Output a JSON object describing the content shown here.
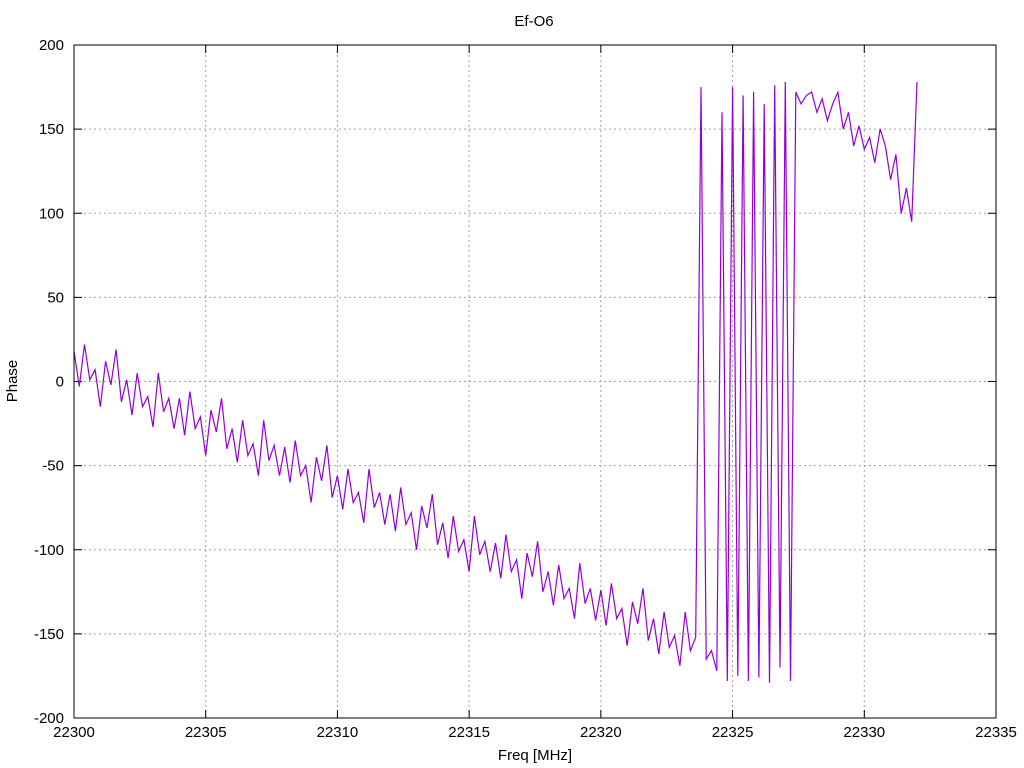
{
  "chart_data": {
    "type": "line",
    "title": "Ef-O6",
    "xlabel": "Freq [MHz]",
    "ylabel": "Phase",
    "xlim": [
      22300,
      22335
    ],
    "ylim": [
      -200,
      200
    ],
    "xticks": [
      22300,
      22305,
      22310,
      22315,
      22320,
      22325,
      22330,
      22335
    ],
    "yticks": [
      -200,
      -150,
      -100,
      -50,
      0,
      50,
      100,
      150,
      200
    ],
    "grid": true,
    "series": [
      {
        "name": "Phase",
        "color": "#9400d3",
        "x_start": 22300,
        "x_step": 0.2,
        "y": [
          18,
          -3,
          22,
          1,
          7,
          -15,
          12,
          -2,
          19,
          -12,
          1,
          -20,
          5,
          -15,
          -9,
          -27,
          5,
          -18,
          -10,
          -28,
          -10,
          -32,
          -6,
          -28,
          -21,
          -44,
          -17,
          -30,
          -10,
          -40,
          -28,
          -48,
          -23,
          -44,
          -37,
          -56,
          -23,
          -47,
          -38,
          -56,
          -39,
          -60,
          -35,
          -56,
          -50,
          -72,
          -45,
          -59,
          -38,
          -69,
          -56,
          -76,
          -52,
          -72,
          -66,
          -84,
          -52,
          -75,
          -66,
          -85,
          -67,
          -89,
          -63,
          -85,
          -78,
          -100,
          -74,
          -87,
          -67,
          -97,
          -84,
          -105,
          -80,
          -101,
          -94,
          -113,
          -80,
          -103,
          -95,
          -113,
          -96,
          -117,
          -91,
          -113,
          -106,
          -129,
          -102,
          -116,
          -95,
          -125,
          -113,
          -133,
          -109,
          -129,
          -123,
          -141,
          -108,
          -132,
          -123,
          -142,
          -124,
          -145,
          -120,
          -141,
          -135,
          -157,
          -131,
          -144,
          -123,
          -154,
          -141,
          -162,
          -137,
          -158,
          -151,
          -169,
          -137,
          -160,
          -152,
          175,
          -165,
          -160,
          -172,
          160,
          -178,
          175,
          -175,
          170,
          -178,
          172,
          -176,
          165,
          -179,
          176,
          -170,
          178,
          -178,
          172,
          165,
          170,
          172,
          160,
          168,
          155,
          165,
          172,
          150,
          160,
          140,
          152,
          138,
          145,
          130,
          150,
          140,
          120,
          135,
          100,
          115,
          95,
          178
        ]
      }
    ]
  }
}
